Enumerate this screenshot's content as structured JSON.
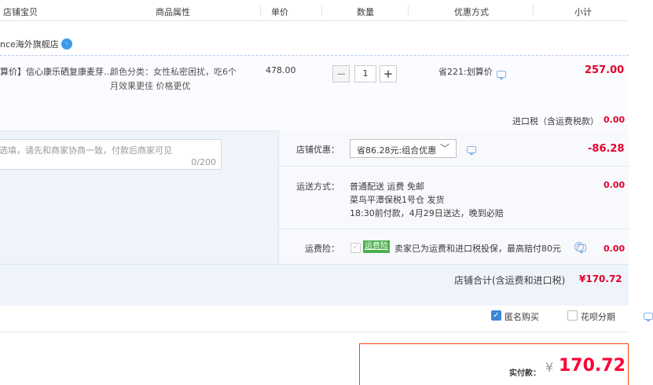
{
  "header": {
    "col_item": "店铺宝贝",
    "col_attr": "商品属性",
    "col_price": "单价",
    "col_qty": "数量",
    "col_discount": "优惠方式",
    "col_subtotal": "小计"
  },
  "shop": {
    "name": "nce海外旗舰店",
    "badge_icon": "aliwangwang-chat-icon"
  },
  "item": {
    "title": "算价】信心康乐硒复康麦芽...",
    "attr_line1": "颜色分类：女性私密困扰，吃6个",
    "attr_line2": "月效果更佳 价格更优",
    "price": "478.00",
    "quantity": "1",
    "minus": "−",
    "plus": "+",
    "discount": "省221:划算价",
    "subtotal": "257.00"
  },
  "tax": {
    "label": "进口税（含运费税款）",
    "value": "0.00"
  },
  "message": {
    "placeholder": "选填，请先和商家协商一致，付款后商家可见",
    "counter": "0/200"
  },
  "shop_discount": {
    "label": "店铺优惠：",
    "selected": "省86.28元:组合优惠",
    "value": "-86.28"
  },
  "shipping": {
    "label": "运送方式：",
    "line1": "普通配送 运费 免邮",
    "line2": "菜鸟平潭保税1号仓   发货",
    "line3": "18:30前付款，4月29日送达，晚到必赔",
    "value": "0.00"
  },
  "insurance": {
    "label": "运费险：",
    "tag": "运费险",
    "text": "卖家已为运费和进口税投保，最高赔付80元",
    "value": "0.00"
  },
  "shop_total": {
    "label": "店铺合计(含运费和进口税)",
    "value": "¥170.72"
  },
  "options": {
    "anonymous": "匿名购买",
    "huabei": "花呗分期",
    "anonymous_checked": true,
    "huabei_checked": false
  },
  "payment": {
    "label": "实付款：",
    "currency": "¥",
    "value": "170.72"
  },
  "colors": {
    "accent_red": "#ff0036",
    "brand_orange": "#ff4400",
    "panel_blue": "#eff4fb",
    "checkbox_blue": "#3d85d8",
    "tag_green": "#4cae4c"
  }
}
